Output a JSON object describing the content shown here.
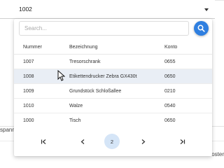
{
  "select": {
    "value": "1002"
  },
  "search": {
    "placeholder": "Search..."
  },
  "table": {
    "headers": {
      "number": "Nummer",
      "description": "Bezeichnung",
      "account": "Konto"
    },
    "rows": [
      {
        "number": "1007",
        "description": "Tresorschrank",
        "account": "0655"
      },
      {
        "number": "1008",
        "description": "Etikettendrucker Zebra GX430t",
        "account": "0650"
      },
      {
        "number": "1009",
        "description": "Grundstück Schloßallee",
        "account": "0210"
      },
      {
        "number": "1010",
        "description": "Walze",
        "account": "0540"
      },
      {
        "number": "1000",
        "description": "Tisch",
        "account": "0650"
      }
    ],
    "highlighted_row": 1
  },
  "pagination": {
    "current_page": "2"
  },
  "background": {
    "left_fragment": "spann",
    "right_fragment": "oster"
  },
  "colors": {
    "accent": "#2f7fe0",
    "row_highlight": "#e9eef5",
    "page_highlight": "#d5e5f7"
  },
  "icons": [
    "chevron-down-icon",
    "search-icon",
    "first-page-icon",
    "previous-page-icon",
    "next-page-icon",
    "last-page-icon",
    "mouse-cursor-icon"
  ]
}
